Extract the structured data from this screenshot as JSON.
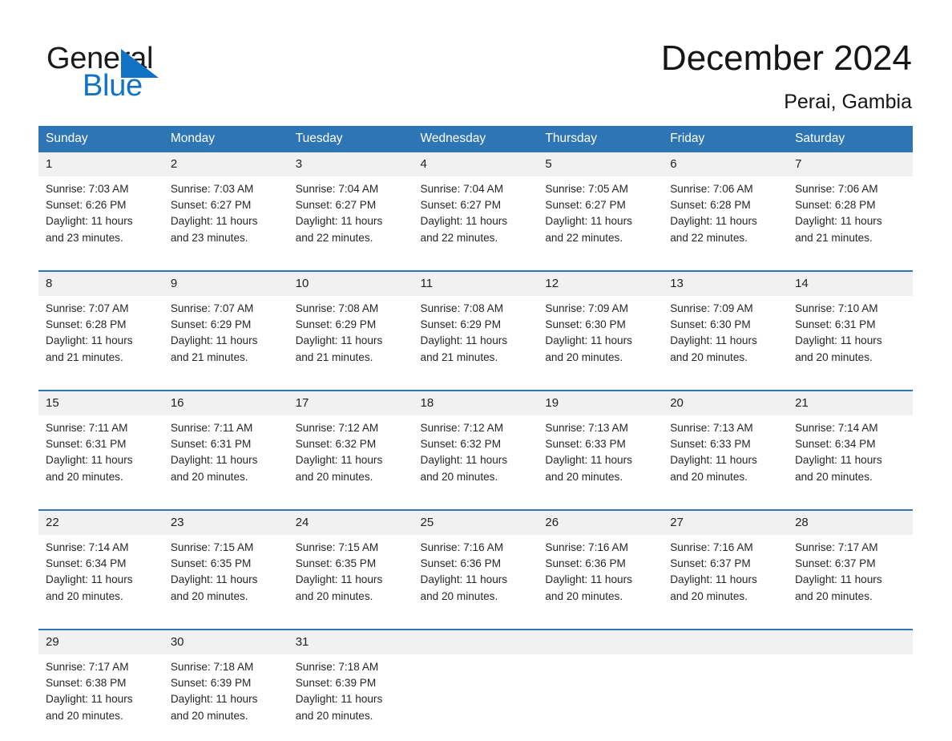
{
  "brand": {
    "name_part1": "General",
    "name_part2": "Blue",
    "triangle_color": "#1273c4",
    "text_color": "#1a1a1a"
  },
  "header": {
    "month_title": "December 2024",
    "location": "Perai, Gambia"
  },
  "theme": {
    "header_blue": "#2e75b6",
    "daynum_band": "#f1f1f1",
    "body_text": "#262626"
  },
  "calendar": {
    "weekday_headers": [
      "Sunday",
      "Monday",
      "Tuesday",
      "Wednesday",
      "Thursday",
      "Friday",
      "Saturday"
    ],
    "weeks": [
      [
        {
          "day": "1",
          "sunrise": "Sunrise: 7:03 AM",
          "sunset": "Sunset: 6:26 PM",
          "daylight_l1": "Daylight: 11 hours",
          "daylight_l2": "and 23 minutes."
        },
        {
          "day": "2",
          "sunrise": "Sunrise: 7:03 AM",
          "sunset": "Sunset: 6:27 PM",
          "daylight_l1": "Daylight: 11 hours",
          "daylight_l2": "and 23 minutes."
        },
        {
          "day": "3",
          "sunrise": "Sunrise: 7:04 AM",
          "sunset": "Sunset: 6:27 PM",
          "daylight_l1": "Daylight: 11 hours",
          "daylight_l2": "and 22 minutes."
        },
        {
          "day": "4",
          "sunrise": "Sunrise: 7:04 AM",
          "sunset": "Sunset: 6:27 PM",
          "daylight_l1": "Daylight: 11 hours",
          "daylight_l2": "and 22 minutes."
        },
        {
          "day": "5",
          "sunrise": "Sunrise: 7:05 AM",
          "sunset": "Sunset: 6:27 PM",
          "daylight_l1": "Daylight: 11 hours",
          "daylight_l2": "and 22 minutes."
        },
        {
          "day": "6",
          "sunrise": "Sunrise: 7:06 AM",
          "sunset": "Sunset: 6:28 PM",
          "daylight_l1": "Daylight: 11 hours",
          "daylight_l2": "and 22 minutes."
        },
        {
          "day": "7",
          "sunrise": "Sunrise: 7:06 AM",
          "sunset": "Sunset: 6:28 PM",
          "daylight_l1": "Daylight: 11 hours",
          "daylight_l2": "and 21 minutes."
        }
      ],
      [
        {
          "day": "8",
          "sunrise": "Sunrise: 7:07 AM",
          "sunset": "Sunset: 6:28 PM",
          "daylight_l1": "Daylight: 11 hours",
          "daylight_l2": "and 21 minutes."
        },
        {
          "day": "9",
          "sunrise": "Sunrise: 7:07 AM",
          "sunset": "Sunset: 6:29 PM",
          "daylight_l1": "Daylight: 11 hours",
          "daylight_l2": "and 21 minutes."
        },
        {
          "day": "10",
          "sunrise": "Sunrise: 7:08 AM",
          "sunset": "Sunset: 6:29 PM",
          "daylight_l1": "Daylight: 11 hours",
          "daylight_l2": "and 21 minutes."
        },
        {
          "day": "11",
          "sunrise": "Sunrise: 7:08 AM",
          "sunset": "Sunset: 6:29 PM",
          "daylight_l1": "Daylight: 11 hours",
          "daylight_l2": "and 21 minutes."
        },
        {
          "day": "12",
          "sunrise": "Sunrise: 7:09 AM",
          "sunset": "Sunset: 6:30 PM",
          "daylight_l1": "Daylight: 11 hours",
          "daylight_l2": "and 20 minutes."
        },
        {
          "day": "13",
          "sunrise": "Sunrise: 7:09 AM",
          "sunset": "Sunset: 6:30 PM",
          "daylight_l1": "Daylight: 11 hours",
          "daylight_l2": "and 20 minutes."
        },
        {
          "day": "14",
          "sunrise": "Sunrise: 7:10 AM",
          "sunset": "Sunset: 6:31 PM",
          "daylight_l1": "Daylight: 11 hours",
          "daylight_l2": "and 20 minutes."
        }
      ],
      [
        {
          "day": "15",
          "sunrise": "Sunrise: 7:11 AM",
          "sunset": "Sunset: 6:31 PM",
          "daylight_l1": "Daylight: 11 hours",
          "daylight_l2": "and 20 minutes."
        },
        {
          "day": "16",
          "sunrise": "Sunrise: 7:11 AM",
          "sunset": "Sunset: 6:31 PM",
          "daylight_l1": "Daylight: 11 hours",
          "daylight_l2": "and 20 minutes."
        },
        {
          "day": "17",
          "sunrise": "Sunrise: 7:12 AM",
          "sunset": "Sunset: 6:32 PM",
          "daylight_l1": "Daylight: 11 hours",
          "daylight_l2": "and 20 minutes."
        },
        {
          "day": "18",
          "sunrise": "Sunrise: 7:12 AM",
          "sunset": "Sunset: 6:32 PM",
          "daylight_l1": "Daylight: 11 hours",
          "daylight_l2": "and 20 minutes."
        },
        {
          "day": "19",
          "sunrise": "Sunrise: 7:13 AM",
          "sunset": "Sunset: 6:33 PM",
          "daylight_l1": "Daylight: 11 hours",
          "daylight_l2": "and 20 minutes."
        },
        {
          "day": "20",
          "sunrise": "Sunrise: 7:13 AM",
          "sunset": "Sunset: 6:33 PM",
          "daylight_l1": "Daylight: 11 hours",
          "daylight_l2": "and 20 minutes."
        },
        {
          "day": "21",
          "sunrise": "Sunrise: 7:14 AM",
          "sunset": "Sunset: 6:34 PM",
          "daylight_l1": "Daylight: 11 hours",
          "daylight_l2": "and 20 minutes."
        }
      ],
      [
        {
          "day": "22",
          "sunrise": "Sunrise: 7:14 AM",
          "sunset": "Sunset: 6:34 PM",
          "daylight_l1": "Daylight: 11 hours",
          "daylight_l2": "and 20 minutes."
        },
        {
          "day": "23",
          "sunrise": "Sunrise: 7:15 AM",
          "sunset": "Sunset: 6:35 PM",
          "daylight_l1": "Daylight: 11 hours",
          "daylight_l2": "and 20 minutes."
        },
        {
          "day": "24",
          "sunrise": "Sunrise: 7:15 AM",
          "sunset": "Sunset: 6:35 PM",
          "daylight_l1": "Daylight: 11 hours",
          "daylight_l2": "and 20 minutes."
        },
        {
          "day": "25",
          "sunrise": "Sunrise: 7:16 AM",
          "sunset": "Sunset: 6:36 PM",
          "daylight_l1": "Daylight: 11 hours",
          "daylight_l2": "and 20 minutes."
        },
        {
          "day": "26",
          "sunrise": "Sunrise: 7:16 AM",
          "sunset": "Sunset: 6:36 PM",
          "daylight_l1": "Daylight: 11 hours",
          "daylight_l2": "and 20 minutes."
        },
        {
          "day": "27",
          "sunrise": "Sunrise: 7:16 AM",
          "sunset": "Sunset: 6:37 PM",
          "daylight_l1": "Daylight: 11 hours",
          "daylight_l2": "and 20 minutes."
        },
        {
          "day": "28",
          "sunrise": "Sunrise: 7:17 AM",
          "sunset": "Sunset: 6:37 PM",
          "daylight_l1": "Daylight: 11 hours",
          "daylight_l2": "and 20 minutes."
        }
      ],
      [
        {
          "day": "29",
          "sunrise": "Sunrise: 7:17 AM",
          "sunset": "Sunset: 6:38 PM",
          "daylight_l1": "Daylight: 11 hours",
          "daylight_l2": "and 20 minutes."
        },
        {
          "day": "30",
          "sunrise": "Sunrise: 7:18 AM",
          "sunset": "Sunset: 6:39 PM",
          "daylight_l1": "Daylight: 11 hours",
          "daylight_l2": "and 20 minutes."
        },
        {
          "day": "31",
          "sunrise": "Sunrise: 7:18 AM",
          "sunset": "Sunset: 6:39 PM",
          "daylight_l1": "Daylight: 11 hours",
          "daylight_l2": "and 20 minutes."
        },
        {
          "day": "",
          "sunrise": "",
          "sunset": "",
          "daylight_l1": "",
          "daylight_l2": ""
        },
        {
          "day": "",
          "sunrise": "",
          "sunset": "",
          "daylight_l1": "",
          "daylight_l2": ""
        },
        {
          "day": "",
          "sunrise": "",
          "sunset": "",
          "daylight_l1": "",
          "daylight_l2": ""
        },
        {
          "day": "",
          "sunrise": "",
          "sunset": "",
          "daylight_l1": "",
          "daylight_l2": ""
        }
      ]
    ]
  }
}
